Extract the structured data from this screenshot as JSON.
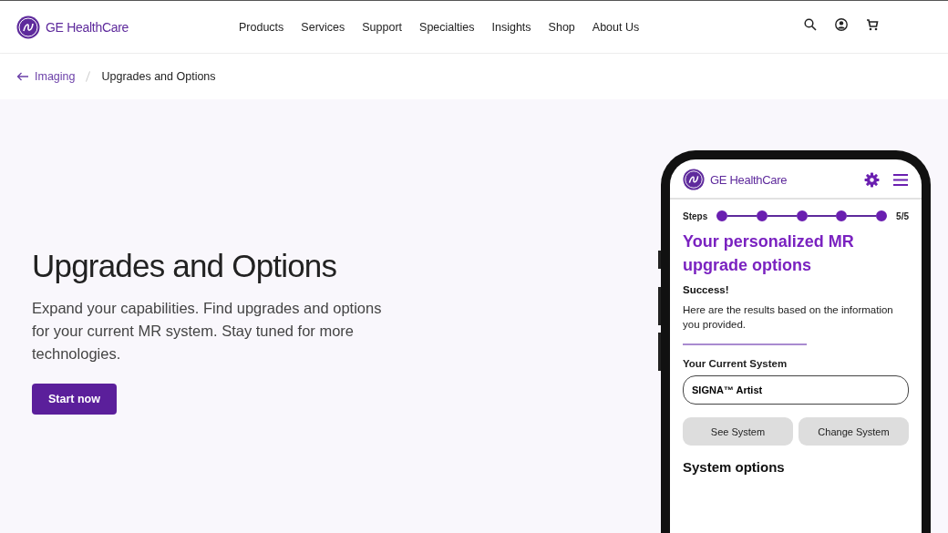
{
  "header": {
    "brand": "GE HealthCare",
    "nav": [
      "Products",
      "Services",
      "Support",
      "Specialties",
      "Insights",
      "Shop",
      "About Us"
    ]
  },
  "breadcrumb": {
    "back": "Imaging",
    "current": "Upgrades and Options"
  },
  "hero": {
    "title": "Upgrades and Options",
    "text": "Expand your capabilities. Find upgrades and options for your current MR system. Stay tuned for more technologies.",
    "button": "Start now"
  },
  "phone": {
    "brand": "GE HealthCare",
    "steps_label": "Steps",
    "steps": [
      {
        "completed": true
      },
      {
        "completed": true
      },
      {
        "completed": true
      },
      {
        "completed": true
      },
      {
        "completed": true
      }
    ],
    "steps_count": "5/5",
    "title": "Your personalized MR upgrade options",
    "success": "Success!",
    "message": "Here are the results based on the information you provided.",
    "system_label": "Your Current System",
    "system_value": "SIGNA™ Artist",
    "buttons": [
      "See System",
      "Change System"
    ],
    "options_title": "System options"
  }
}
